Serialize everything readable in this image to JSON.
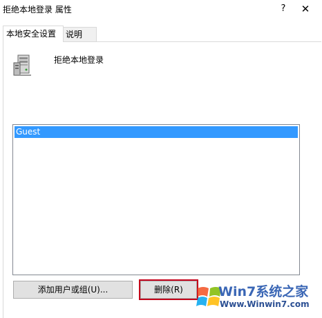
{
  "window": {
    "title": "拒绝本地登录 属性",
    "help_label": "?",
    "close_label": "✕"
  },
  "tabs": [
    {
      "label": "本地安全设置",
      "active": true
    },
    {
      "label": "说明",
      "active": false
    }
  ],
  "policy": {
    "icon": "server-icon",
    "name": "拒绝本地登录"
  },
  "members": {
    "items": [
      "Guest"
    ],
    "selected": "Guest",
    "selection_color": "#3399ff"
  },
  "buttons": {
    "add_label": "添加用户或组(U)...",
    "remove_label": "删除(R)"
  },
  "watermark": {
    "brand": "Win7系统之家",
    "url": "Www.Winwin7.com"
  },
  "colors": {
    "highlight_border": "#c4001a"
  }
}
